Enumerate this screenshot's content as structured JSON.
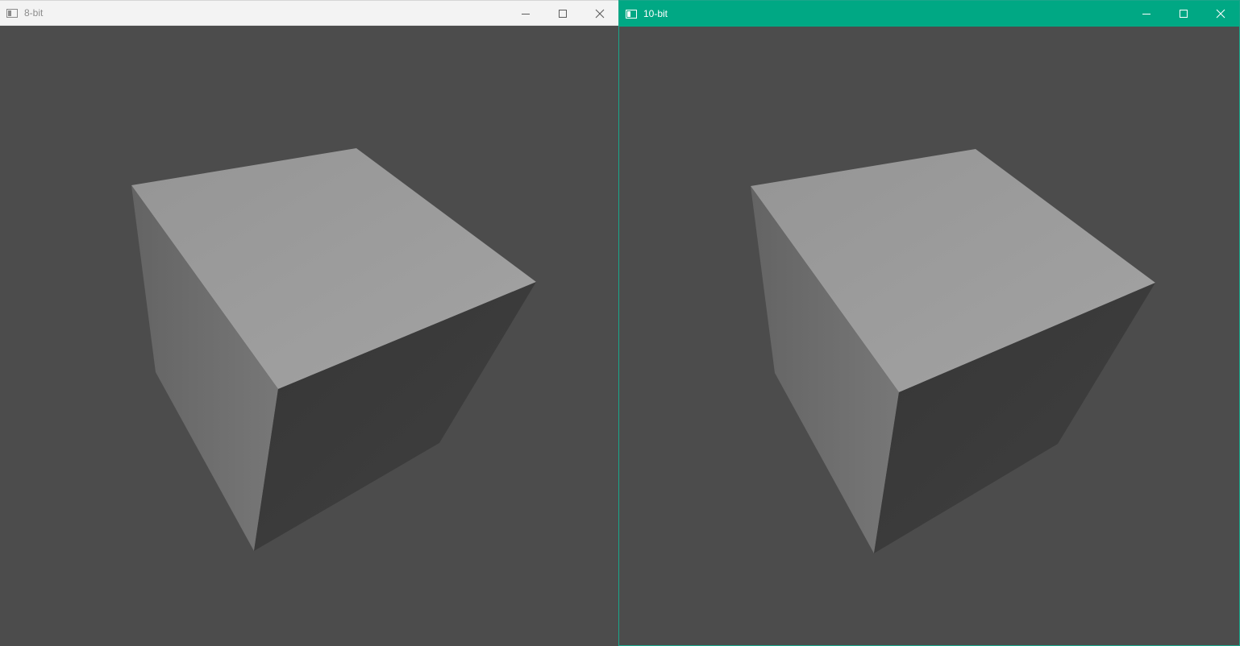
{
  "windows": [
    {
      "title": "8-bit",
      "controls": {
        "minimize": "minimize",
        "maximize": "maximize",
        "close": "close"
      },
      "scene": {
        "background": "#4c4c4c",
        "object": "cube"
      }
    },
    {
      "title": "10-bit",
      "controls": {
        "minimize": "minimize",
        "maximize": "maximize",
        "close": "close"
      },
      "scene": {
        "background": "#4c4c4c",
        "object": "cube"
      }
    }
  ],
  "colors": {
    "active_titlebar": "#00a884",
    "inactive_titlebar": "#f3f3f3",
    "cube_top": "#9c9c9c",
    "cube_left": "#6c6c6c",
    "cube_right": "#3d3d3d"
  }
}
